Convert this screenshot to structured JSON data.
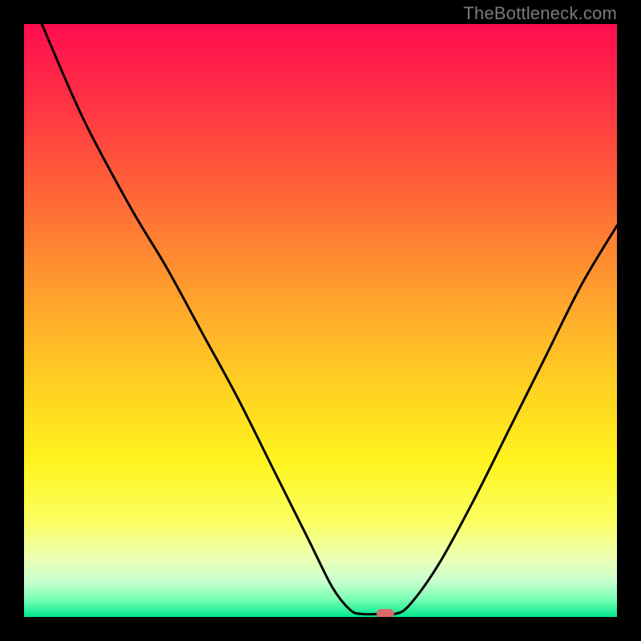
{
  "watermark": "TheBottleneck.com",
  "colors": {
    "curve": "#000000",
    "marker": "#d86a6a",
    "frame": "#000000"
  },
  "chart_data": {
    "type": "line",
    "title": "",
    "xlabel": "",
    "ylabel": "",
    "xlim": [
      0,
      100
    ],
    "ylim": [
      0,
      100
    ],
    "gradient_stops": [
      {
        "pos": 0,
        "color": "#ff0d4f"
      },
      {
        "pos": 12,
        "color": "#ff2e45"
      },
      {
        "pos": 30,
        "color": "#ff6a36"
      },
      {
        "pos": 48,
        "color": "#ffa82b"
      },
      {
        "pos": 62,
        "color": "#ffd321"
      },
      {
        "pos": 74,
        "color": "#fff41f"
      },
      {
        "pos": 84,
        "color": "#fbff62"
      },
      {
        "pos": 90,
        "color": "#edffb2"
      },
      {
        "pos": 94,
        "color": "#c8ffcf"
      },
      {
        "pos": 97,
        "color": "#7affb4"
      },
      {
        "pos": 100,
        "color": "#00e98e"
      }
    ],
    "series": [
      {
        "name": "bottleneck-curve",
        "points": [
          {
            "x": 3.0,
            "y": 100.0
          },
          {
            "x": 10.0,
            "y": 84.0
          },
          {
            "x": 18.0,
            "y": 69.0
          },
          {
            "x": 24.0,
            "y": 59.0
          },
          {
            "x": 30.0,
            "y": 48.0
          },
          {
            "x": 36.0,
            "y": 37.0
          },
          {
            "x": 42.0,
            "y": 25.0
          },
          {
            "x": 48.0,
            "y": 13.0
          },
          {
            "x": 52.0,
            "y": 5.0
          },
          {
            "x": 55.0,
            "y": 1.2
          },
          {
            "x": 57.0,
            "y": 0.5
          },
          {
            "x": 60.0,
            "y": 0.5
          },
          {
            "x": 62.5,
            "y": 0.5
          },
          {
            "x": 65.0,
            "y": 2.0
          },
          {
            "x": 70.0,
            "y": 9.0
          },
          {
            "x": 76.0,
            "y": 20.0
          },
          {
            "x": 82.0,
            "y": 32.0
          },
          {
            "x": 88.0,
            "y": 44.0
          },
          {
            "x": 94.0,
            "y": 56.0
          },
          {
            "x": 100.0,
            "y": 66.0
          }
        ]
      }
    ],
    "marker": {
      "x": 61.0,
      "y": 0.5
    }
  }
}
